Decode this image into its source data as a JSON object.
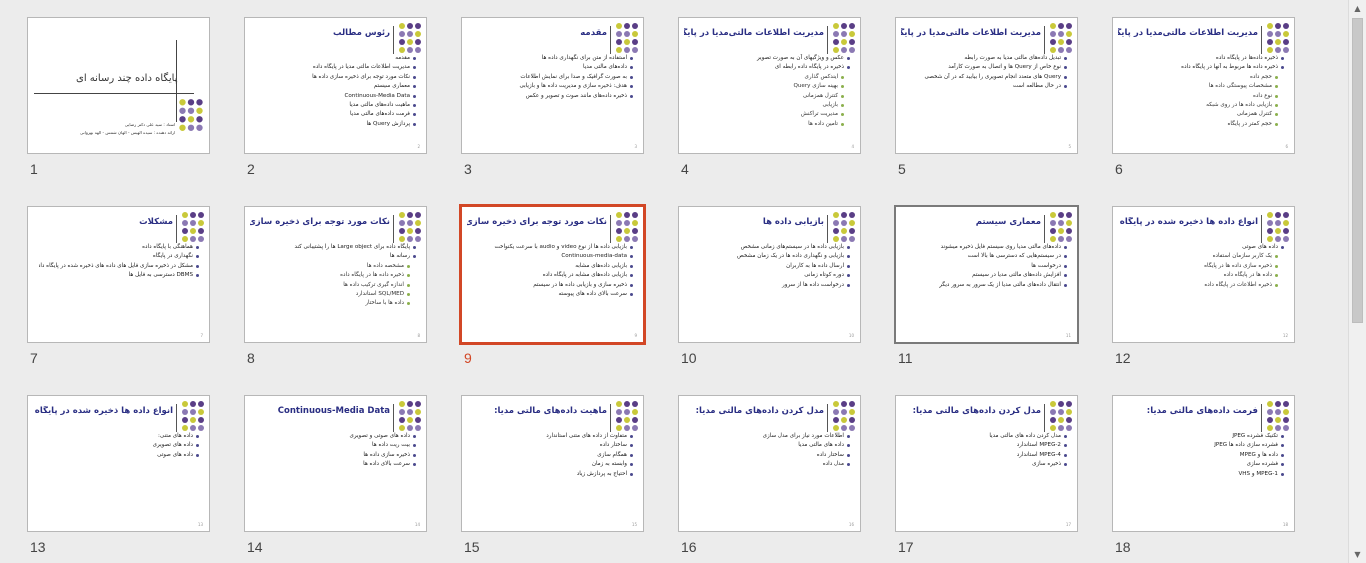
{
  "slides": [
    {
      "n": "1",
      "title": "پایگاه داده چند رسانه ای",
      "bullets": [],
      "type": "title",
      "sub1": "استاد : سید علی دکتر رضایی",
      "sub2": "ارائه دهنده : سیده الهیس - الهان شمس - الهه بهروانی"
    },
    {
      "n": "2",
      "title": "رئوس مطالب",
      "bullets": [
        "مقدمه",
        "مدیریت اطلاعات مالتی مدیا در پایگاه داده",
        "نکات مورد توجه برای ذخیره سازی داده ها",
        "معماری سیستم",
        "Continuous-Media Data",
        "ماهیت داده‌های مالتی مدیا",
        "فرمت داده‌های مالتی مدیا",
        "پردازش Query ها"
      ]
    },
    {
      "n": "3",
      "title": "مقدمه",
      "bullets": [
        "استفاده از متن برای نگهداری داده ها",
        "داده‌های مالتی مدیا",
        "به صورت گرافیک و صدا برای نمایش اطلاعات",
        "هدف: ذخیره سازی و مدیریت داده ها و بازیابی",
        "ذخیره داده‌های مانند صوت و تصویر و عکس"
      ]
    },
    {
      "n": "4",
      "title": "مدیریت اطلاعات مالتی‌مدیا در پایگاه داده:",
      "bullets": [
        "عکس و ویژگیهای آن به صورت تصویر",
        "ذخیره در پایگاه داده رابطه ای"
      ],
      "subs": [
        "ایندکس گذاری",
        "بهینه سازی Query",
        "کنترل همزمانی",
        "بازیابی",
        "مدیریت تراکنش",
        "تامین داده ها"
      ]
    },
    {
      "n": "5",
      "title": "مدیریت اطلاعات مالتی‌مدیا در پایگاه داده:",
      "bullets": [
        "تبدیل داده‌های مالتی مدیا به صورت رابطه",
        "نوع خاص از Query ها و اتصال به صورت کارآمد",
        "Query های متعدد انجام تصویری را بیابید که در آن شخصی",
        "در حال مطالعه است"
      ]
    },
    {
      "n": "6",
      "title": "مدیریت اطلاعات مالتی‌مدیا در پایگاه داده:",
      "bullets": [
        "ذخیره داده‌ها در پایگاه داده",
        "ذخیره داده ها مربوط به آنها در پایگاه داده"
      ],
      "subs": [
        "حجم داده",
        "مشخصات پیوستگی داده ها",
        "نوع داده",
        "بازیابی داده ها در روی شبکه",
        "کنترل همزمانی",
        "حجم کمتر در پایگاه"
      ]
    },
    {
      "n": "7",
      "title": "مشکلات",
      "bullets": [
        "هماهنگی با پایگاه داده",
        "نگهداری در پایگاه",
        "مشکل در ذخیره سازی فایل های داده های ذخیره شده در پایگاه داده",
        "DBMS دسترسی به فایل ها"
      ]
    },
    {
      "n": "8",
      "title": "نکات مورد توجه برای ذخیره سازی داده ها",
      "bullets": [
        "پایگاه داده برای Large object ها را پشتیبانی کند",
        "رسانه ها"
      ],
      "subs": [
        "مشخصه داده ها",
        "ذخیره داده ها در پایگاه داده",
        "اندازه گیری ترکیب داده ها",
        "SQL/MED استاندارد",
        "داده ها با ساختار"
      ]
    },
    {
      "n": "9",
      "title": "نکات مورد توجه برای ذخیره سازی داده ها",
      "bullets": [
        "بازیابی داده ها از نوع video و audio با سرعت یکنواخت",
        "Continuous-media-data",
        "بازیابی داده‌های مشابه",
        "بازیابی داده‌های مشابه در پایگاه داده",
        "ذخیره سازی و بازیابی داده ها در سیستم",
        "سرعت بالای داده های پیوسته"
      ]
    },
    {
      "n": "10",
      "title": "بازیابی داده ها",
      "bullets": [
        "بازیابی داده ها در سیستم‌های زمانی مشخص",
        "بازیابی و نگهداری داده ها در یک زمان مشخص",
        "ارسال داده ها به کاربران",
        "دوره کوتاه زمانی",
        "درخواست داده ها از سرور"
      ]
    },
    {
      "n": "11",
      "title": "معماری سیستم",
      "bullets": [
        "داده‌های مالتی مدیا روی سیستم فایل ذخیره میشوند",
        "در سیستم‌هایی که دسترسی ها بالا است",
        "درخواست ها",
        "افزایش داده‌های مالتی مدیا در سیستم",
        "انتقال داده‌های مالتی مدیا از یک سرور به سرور دیگر"
      ]
    },
    {
      "n": "12",
      "title": "انواع داده ها ذخیره شده در پایگاه داده",
      "bullets": [
        "داده های صوتی"
      ],
      "subs": [
        "یک کاربر سازمان استفاده",
        "ذخیره سازی داده ها در پایگاه",
        "داده ها در پایگاه داده",
        "ذخیره اطلاعات در پایگاه داده"
      ]
    },
    {
      "n": "13",
      "title": "انواع داده ها ذخیره شده در پایگاه داده",
      "bullets": [
        "داده های متنی:",
        "داده های تصویری",
        "داده های صوتی"
      ]
    },
    {
      "n": "14",
      "title": "Continuous-Media Data",
      "bullets": [
        "داده های صوتی و تصویری",
        "بیت ریت داده ها",
        "ذخیره سازی داده ها",
        "سرعت بالای داده ها"
      ]
    },
    {
      "n": "15",
      "title": "ماهیت داده‌های مالتی مدیا:",
      "bullets": [
        "متفاوت از داده های متنی استاندارد",
        "ساختار داده",
        "همگام سازی",
        "وابسته به زمان",
        "احتیاج به پردازش زیاد"
      ]
    },
    {
      "n": "16",
      "title": "مدل کردن داده‌های مالتی مدیا:",
      "bullets": [
        "اطلاعات مورد نیاز برای مدل سازی",
        "داده های مالتی مدیا",
        "ساختار داده",
        "مدل داده"
      ]
    },
    {
      "n": "17",
      "title": "مدل کردن داده‌های مالتی مدیا:",
      "bullets": [
        "مدل کردن داده های مالتی مدیا",
        "MPEG-2 استاندارد",
        "MPEG-4 استاندارد",
        "ذخیره سازی"
      ]
    },
    {
      "n": "18",
      "title": "فرمت داده‌های مالتی مدیا:",
      "bullets": [
        "تکنیک فشرده JPEG",
        "فشرده سازی داده ها JPEG",
        "داده ها و MPEG",
        "فشرده سازی",
        "MPEG-1 و VHS"
      ]
    }
  ],
  "selected": "9",
  "hover": "11",
  "colors": {
    "accent": "#d24726",
    "title": "#2a2e83",
    "deco1": "#5a3e86",
    "deco2": "#c9c93a"
  }
}
